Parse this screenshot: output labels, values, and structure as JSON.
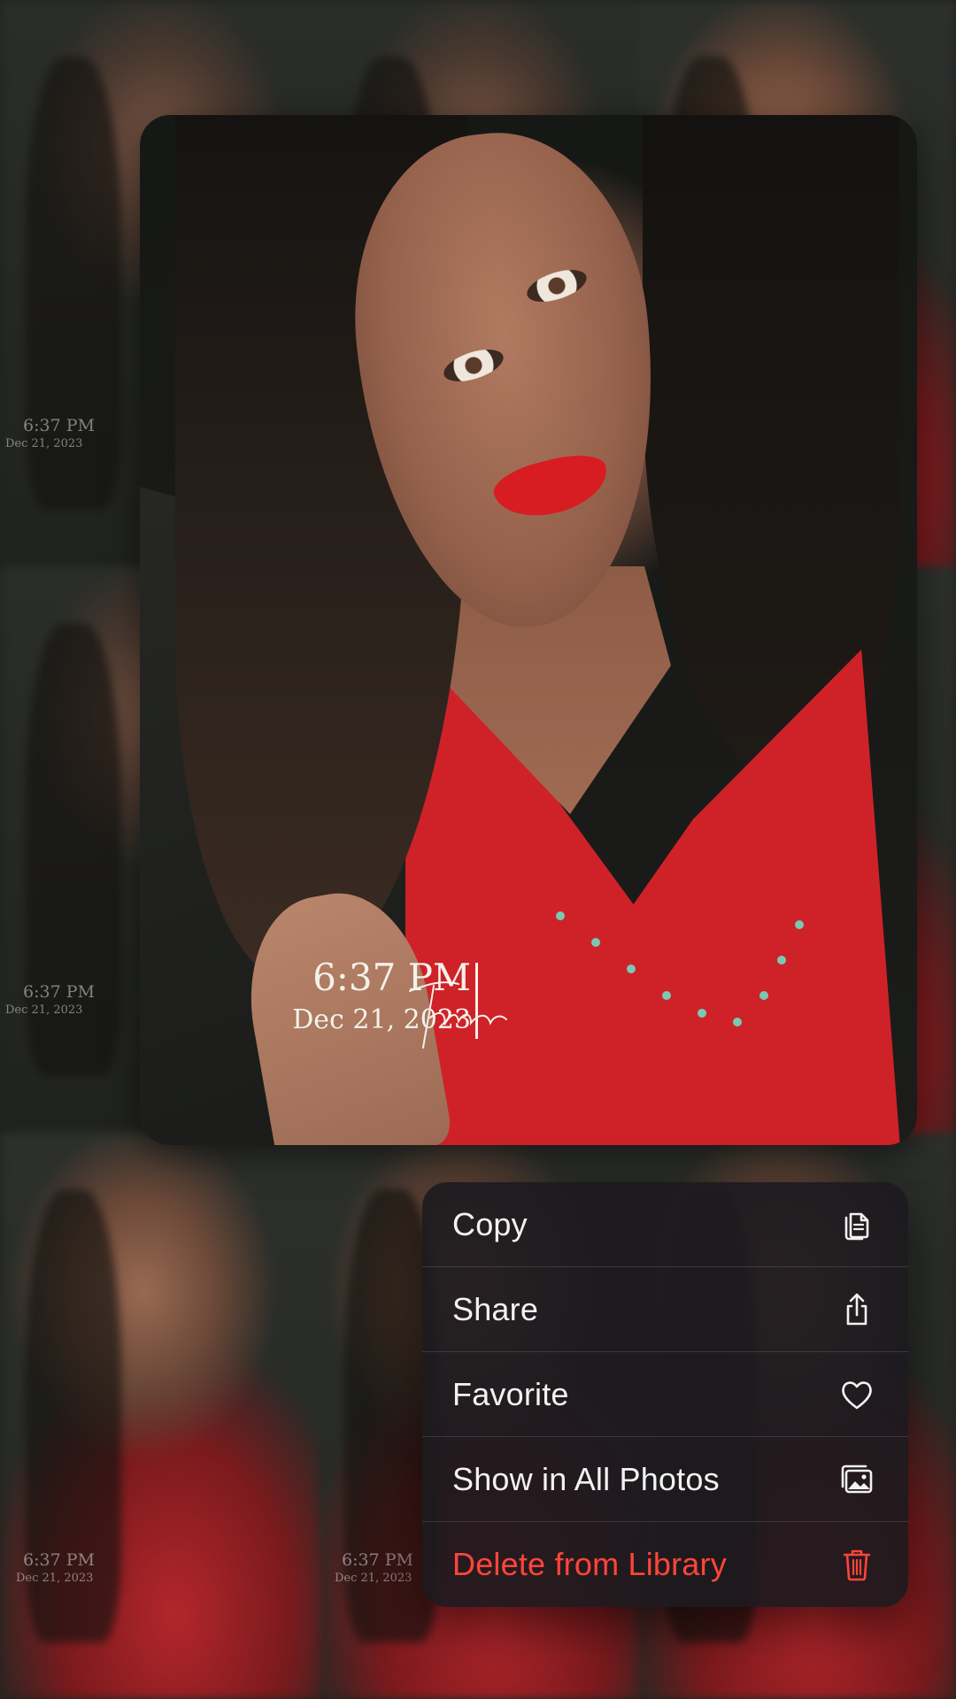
{
  "photo": {
    "timestamp_time": "6:37 PM",
    "timestamp_date": "Dec 21, 2023"
  },
  "background_thumbnails": [
    {
      "time": "6:37 PM",
      "date": "Dec 21, 2023"
    },
    {
      "time": "6:37 PM",
      "date": "Dec 21, 2023"
    },
    {
      "time": "6:37 PM",
      "date": "Dec 21, 2023"
    },
    {
      "time": "6:37 PM",
      "date": "Dec 21, 2023"
    }
  ],
  "context_menu": {
    "items": [
      {
        "label": "Copy",
        "icon": "copy-icon"
      },
      {
        "label": "Share",
        "icon": "share-icon"
      },
      {
        "label": "Favorite",
        "icon": "heart-icon"
      },
      {
        "label": "Show in All Photos",
        "icon": "photos-icon"
      },
      {
        "label": "Delete from Library",
        "icon": "trash-icon",
        "destructive": true
      }
    ]
  },
  "colors": {
    "destructive": "#ff453a",
    "menu_background": "#1c1a1e",
    "shirt_red": "#cf2228"
  }
}
